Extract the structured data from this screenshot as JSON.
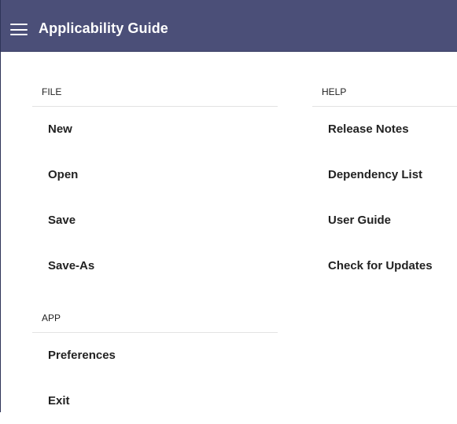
{
  "app": {
    "title": "Applicability Guide"
  },
  "file": {
    "header": "FILE",
    "items": [
      {
        "label": "New"
      },
      {
        "label": "Open"
      },
      {
        "label": "Save"
      },
      {
        "label": "Save-As"
      }
    ]
  },
  "help": {
    "header": "HELP",
    "items": [
      {
        "label": "Release Notes"
      },
      {
        "label": "Dependency List"
      },
      {
        "label": "User Guide"
      },
      {
        "label": "Check for Updates"
      }
    ]
  },
  "appsection": {
    "header": "APP",
    "items": [
      {
        "label": "Preferences"
      },
      {
        "label": "Exit"
      }
    ]
  },
  "colors": {
    "appbar": "#4b4f78",
    "appbar_text": "#ffffff",
    "item_text": "#222222",
    "divider": "#e3e3e3"
  },
  "icons": {
    "menu": "hamburger-menu-icon"
  }
}
